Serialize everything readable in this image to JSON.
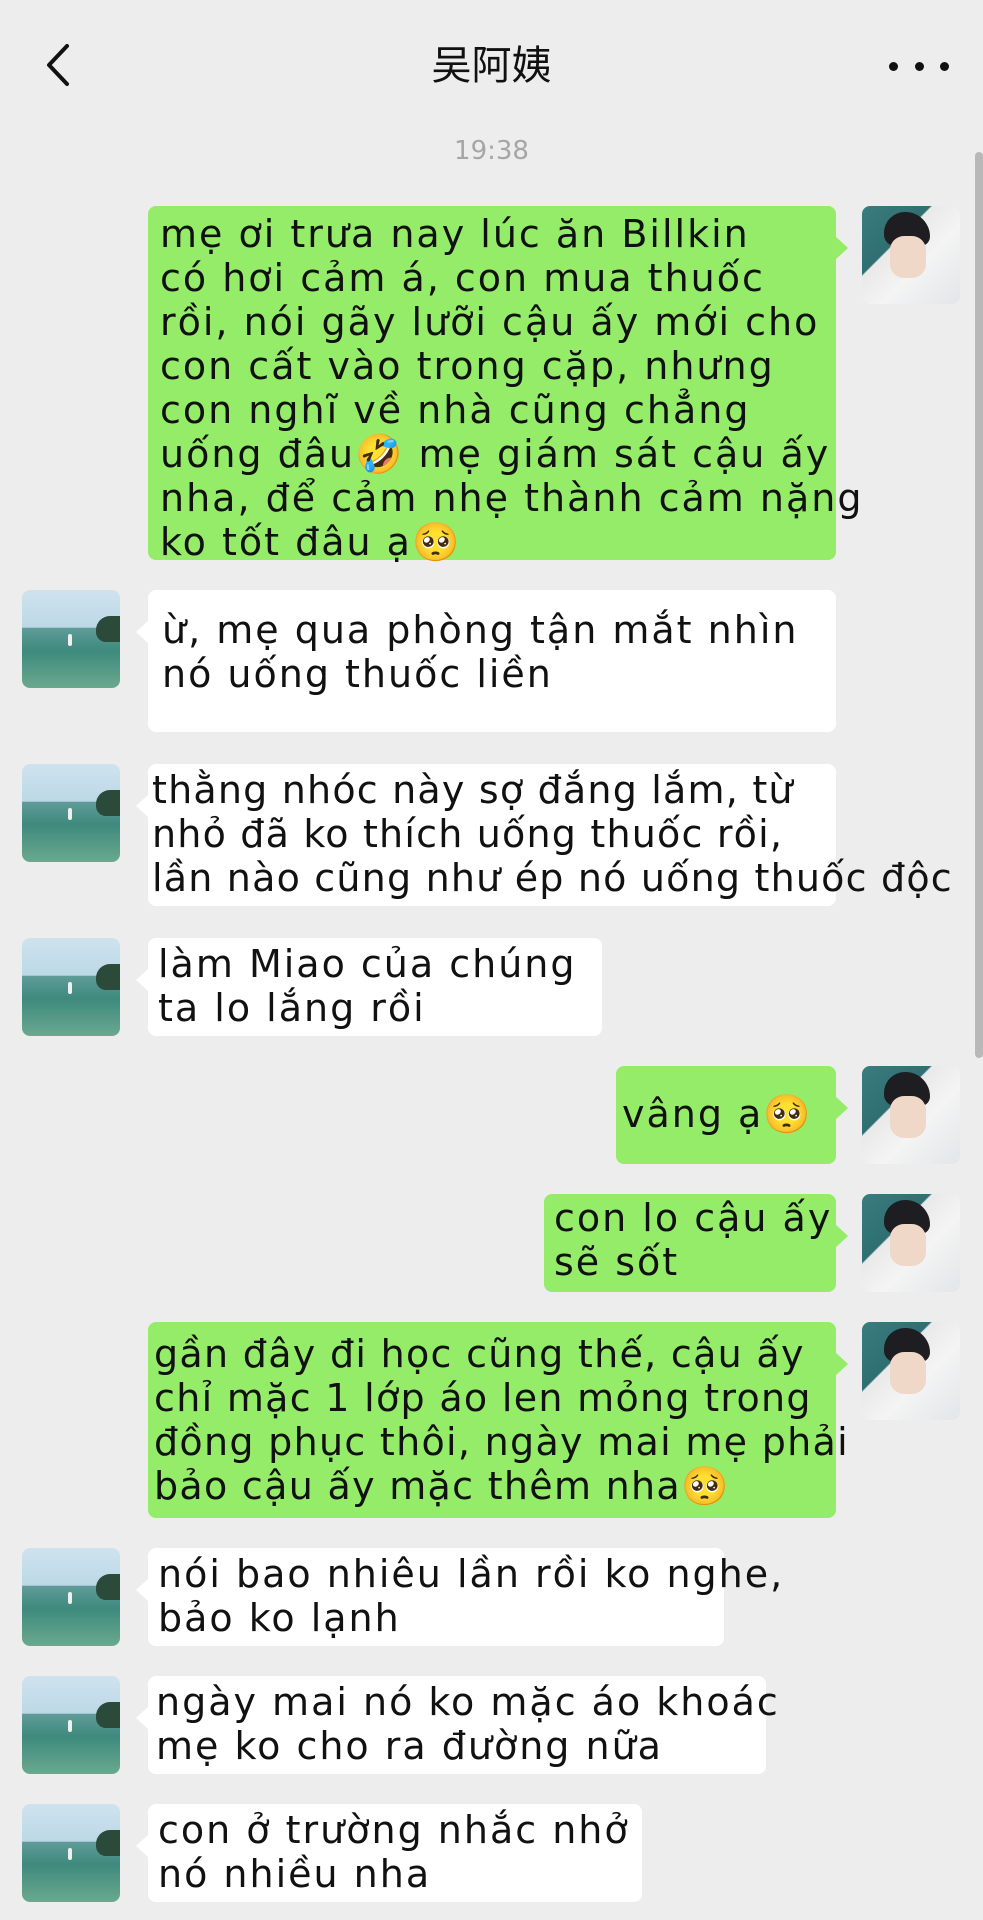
{
  "header": {
    "title": "吴阿姨",
    "back_icon": "chevron-left-icon",
    "more_icon": "more-dots-icon"
  },
  "timestamp": "19:38",
  "colors": {
    "background": "#ededed",
    "self_bubble": "#95ec69",
    "other_bubble": "#ffffff",
    "timestamp": "#a6a6a6"
  },
  "messages": [
    {
      "sender": "self",
      "lines": [
        "mẹ ơi trưa nay lúc ăn Billkin",
        "có hơi cảm á, con mua thuốc",
        "rồi, nói gãy lưỡi cậu ấy mới cho",
        "con cất vào trong cặp, nhưng",
        "con nghĩ về nhà cũng chẳng",
        "uống đâu🤣 mẹ giám sát cậu ấy",
        "nha, để cảm nhẹ thành cảm nặng",
        "ko tốt đâu ạ🥺"
      ]
    },
    {
      "sender": "other",
      "lines": [
        "ừ, mẹ qua phòng tận mắt nhìn",
        "nó uống thuốc liền"
      ]
    },
    {
      "sender": "other",
      "lines": [
        "thằng nhóc này sợ đắng lắm, từ",
        "nhỏ đã ko thích uống thuốc rồi,",
        "lần nào cũng như ép nó uống thuốc độc"
      ]
    },
    {
      "sender": "other",
      "lines": [
        "làm Miao của chúng",
        "ta lo lắng rồi"
      ]
    },
    {
      "sender": "self",
      "lines": [
        "vâng ạ🥺"
      ]
    },
    {
      "sender": "self",
      "lines": [
        "con lo cậu ấy",
        "sẽ sốt"
      ]
    },
    {
      "sender": "self",
      "lines": [
        "gần đây đi học cũng thế, cậu ấy",
        "chỉ mặc 1 lớp áo len mỏng trong",
        "đồng phục thôi, ngày mai mẹ phải",
        "bảo cậu ấy mặc thêm nha🥺"
      ]
    },
    {
      "sender": "other",
      "lines": [
        "nói bao nhiêu lần rồi ko nghe,",
        "bảo ko lạnh"
      ]
    },
    {
      "sender": "other",
      "lines": [
        "ngày mai nó ko mặc áo khoác",
        "mẹ ko cho ra đường nữa"
      ]
    },
    {
      "sender": "other",
      "lines": [
        "con ở trường nhắc nhở",
        "nó nhiều nha"
      ]
    }
  ]
}
